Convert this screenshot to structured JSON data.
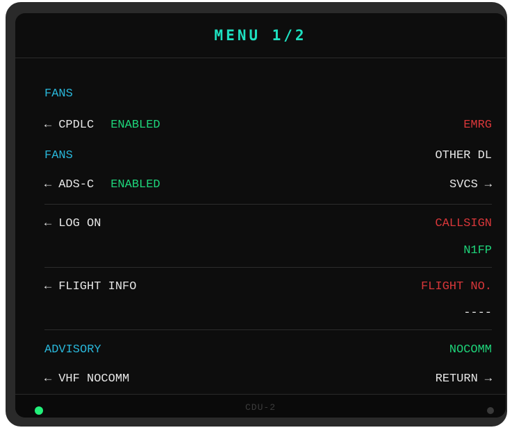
{
  "header": {
    "title": "MENU 1/2"
  },
  "rows": {
    "r1": {
      "left_label": "FANS"
    },
    "r2": {
      "left_arrow": "←",
      "left_label": "CPDLC",
      "left_status": "ENABLED",
      "right_label": "EMRG"
    },
    "r3": {
      "left_label": "FANS",
      "right_label": "OTHER DL"
    },
    "r4": {
      "left_arrow": "←",
      "left_label": "ADS-C",
      "left_status": "ENABLED",
      "right_label": "SVCS",
      "right_arrow": "→"
    },
    "r5": {
      "left_arrow": "←",
      "left_label": "LOG ON",
      "right_label": "CALLSIGN"
    },
    "r6": {
      "right_value": "N1FP"
    },
    "r7": {
      "left_arrow": "←",
      "left_label": "FLIGHT INFO",
      "right_label": "FLIGHT NO."
    },
    "r8": {
      "right_value": "----"
    },
    "r9": {
      "left_label": "ADVISORY",
      "right_label": "NOCOMM"
    },
    "r10": {
      "left_arrow": "←",
      "left_label": "VHF NOCOMM",
      "right_label": "RETURN",
      "right_arrow": "→"
    }
  },
  "footer": {
    "unit_label": "CDU-2",
    "status_led_left": "green-led-icon",
    "status_led_right": "grey-led-icon"
  },
  "colors": {
    "title": "#1ee0c0",
    "cyan": "#29b6d9",
    "green": "#1ed47a",
    "red": "#d9373a",
    "white": "#e6e6e6",
    "background": "#0d0d0d"
  }
}
